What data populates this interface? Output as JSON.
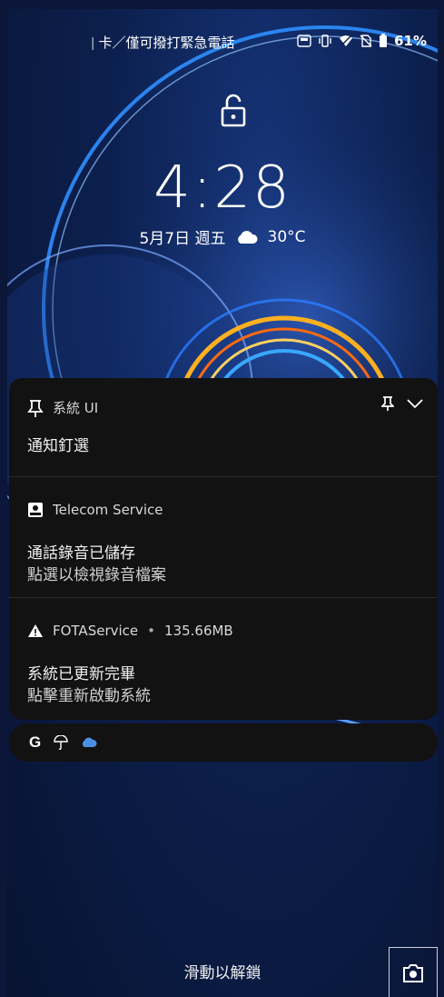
{
  "status_bar": {
    "carrier_text": "卡／僅可撥打緊急電話",
    "battery_percent": "61%",
    "icons": [
      "hd-voice-icon",
      "vibrate-icon",
      "wifi-icon",
      "no-sim-icon",
      "battery-icon"
    ]
  },
  "lockscreen": {
    "lock_state": "unlocked-padlock-icon",
    "time": "4:28",
    "date": "5月7日 週五",
    "weather_icon": "cloud-icon",
    "temperature": "30°C"
  },
  "notifications": [
    {
      "app": "系統 UI",
      "icon": "pin-icon",
      "title": "通知釘選",
      "text": ""
    },
    {
      "app": "Telecom Service",
      "icon": "recorder-icon",
      "title": "通話錄音已儲存",
      "text": "點選以檢視錄音檔案"
    },
    {
      "app": "FOTAService",
      "size": "135.66MB",
      "icon": "warning-icon",
      "title": "系統已更新完畢",
      "text": "點擊重新啟動系統"
    }
  ],
  "tray_icons": [
    "google-icon",
    "umbrella-weather-icon",
    "cloud-storage-icon"
  ],
  "bottom": {
    "swipe_hint": "滑動以解鎖",
    "camera_icon": "camera-icon"
  },
  "colors": {
    "panel_bg": "#121212",
    "wallpaper_bg": "#0c1f4d",
    "accent_orange": "#ffb020",
    "accent_blue": "#2f8fff",
    "cloud_blue": "#4a90e2"
  }
}
